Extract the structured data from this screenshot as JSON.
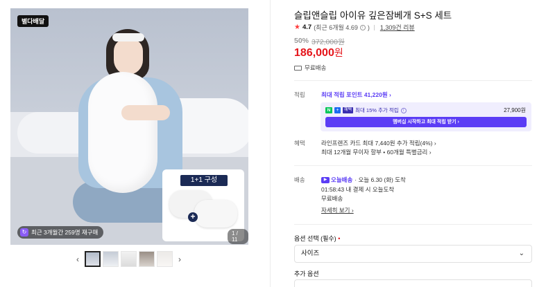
{
  "gallery": {
    "logo_text": "별다배달",
    "inset_label": "1+1 구성",
    "counter": "1 / 11",
    "repurchase_text": "최근 3개월간 259명 재구매",
    "repurchase_icon": "repurchase-icon"
  },
  "thumbnails": {
    "prev": "‹",
    "next": "›"
  },
  "product": {
    "title": "슬립앤슬립 아이유 깊은잠베개 S+S 세트",
    "rating_score": "4.7",
    "rating_recent": "(최근 6개월 4.69",
    "rating_recent_close": ")",
    "review_count": "1,309건 리뷰",
    "discount_rate": "50%",
    "original_price": "372,000원",
    "price": "186,000",
    "price_unit": "원",
    "shipping_free": "무료배송"
  },
  "points": {
    "label": "적립",
    "max_point": "최대 적립 포인트 41,220원 ›",
    "n_badge": "N",
    "plus_badge": "+",
    "grade_badge": "혜택",
    "extra_rate": "최대 15% 추가 적립",
    "extra_amount": "27,900원",
    "cta": "멤버십 시작하고 최대 적립 받기 ›"
  },
  "benefits": {
    "label": "혜택",
    "card": "라인프렌즈 카드 최대 7,440원 추가 적립(4%) ›",
    "installment": "최대 12개월 무이자 할부 • 60개월 특별금리 ›"
  },
  "delivery": {
    "label": "배송",
    "today_badge": "오늘배송",
    "today_eta": "· 오늘 6.30 (화) 도착",
    "countdown": "01:58:43  내 결제 시 오늘도착",
    "free": "무료배송",
    "more": "자세히 보기 ›"
  },
  "options": {
    "label": "옵션 선택 (필수)",
    "required_mark": "•",
    "size_select": "사이즈",
    "add_label": "추가 옵션"
  },
  "colors": {
    "accent": "#5b3df5",
    "price_red": "#e5141a",
    "naver_green": "#03c75a"
  }
}
